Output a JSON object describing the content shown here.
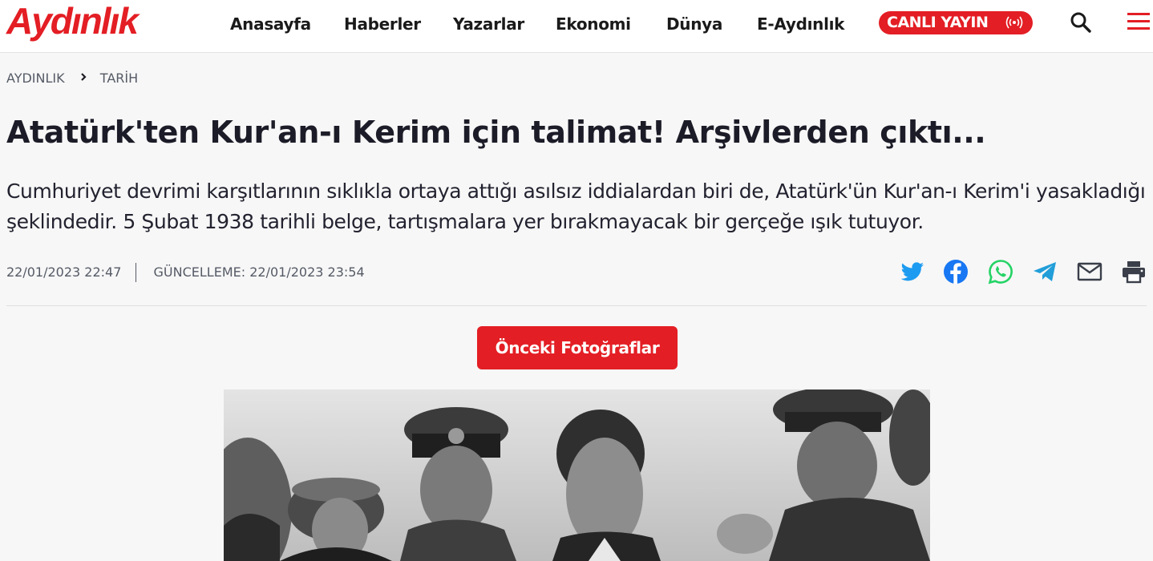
{
  "site": {
    "logo_text": "Aydınlık",
    "brand_color": "#e31e24"
  },
  "nav": {
    "items": [
      "Anasayfa",
      "Haberler",
      "Yazarlar",
      "Ekonomi",
      "Dünya",
      "E-Aydınlık"
    ],
    "live_label": "CANLI YAYIN"
  },
  "breadcrumb": {
    "items": [
      "AYDINLIK",
      "TARİH"
    ]
  },
  "article": {
    "title": "Atatürk'ten Kur'an-ı Kerim için talimat! Arşivlerden çıktı...",
    "summary": "Cumhuriyet devrimi karşıtlarının sıklıkla ortaya attığı asılsız iddialardan biri de, Atatürk'ün Kur'an-ı Kerim'i yasakladığı şeklindedir. 5 Şubat 1938 tarihli belge, tartışmalara yer bırakmayacak bir gerçeğe ışık tutuyor.",
    "published": "22/01/2023 22:47",
    "updated": "GÜNCELLEME: 22/01/2023 23:54",
    "prev_photos_label": "Önceki Fotoğraflar"
  },
  "share": {
    "icons": [
      "twitter-icon",
      "facebook-icon",
      "whatsapp-icon",
      "telegram-icon",
      "mail-icon",
      "print-icon"
    ],
    "colors": {
      "twitter": "#1d9bf0",
      "facebook": "#1877f2",
      "whatsapp": "#25d366",
      "telegram": "#229ed9",
      "neutral": "#3a3f4a"
    }
  }
}
